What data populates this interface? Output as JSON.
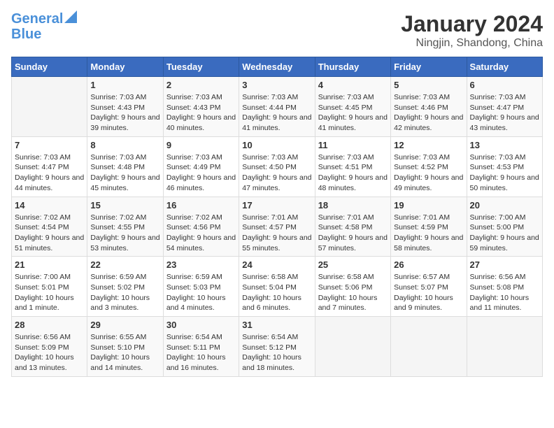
{
  "header": {
    "logo_line1": "General",
    "logo_line2": "Blue",
    "title": "January 2024",
    "subtitle": "Ningjin, Shandong, China"
  },
  "calendar": {
    "weekdays": [
      "Sunday",
      "Monday",
      "Tuesday",
      "Wednesday",
      "Thursday",
      "Friday",
      "Saturday"
    ],
    "weeks": [
      [
        {
          "day": "",
          "info": ""
        },
        {
          "day": "1",
          "info": "Sunrise: 7:03 AM\nSunset: 4:43 PM\nDaylight: 9 hours and 39 minutes."
        },
        {
          "day": "2",
          "info": "Sunrise: 7:03 AM\nSunset: 4:43 PM\nDaylight: 9 hours and 40 minutes."
        },
        {
          "day": "3",
          "info": "Sunrise: 7:03 AM\nSunset: 4:44 PM\nDaylight: 9 hours and 41 minutes."
        },
        {
          "day": "4",
          "info": "Sunrise: 7:03 AM\nSunset: 4:45 PM\nDaylight: 9 hours and 41 minutes."
        },
        {
          "day": "5",
          "info": "Sunrise: 7:03 AM\nSunset: 4:46 PM\nDaylight: 9 hours and 42 minutes."
        },
        {
          "day": "6",
          "info": "Sunrise: 7:03 AM\nSunset: 4:47 PM\nDaylight: 9 hours and 43 minutes."
        }
      ],
      [
        {
          "day": "7",
          "info": "Sunrise: 7:03 AM\nSunset: 4:47 PM\nDaylight: 9 hours and 44 minutes."
        },
        {
          "day": "8",
          "info": "Sunrise: 7:03 AM\nSunset: 4:48 PM\nDaylight: 9 hours and 45 minutes."
        },
        {
          "day": "9",
          "info": "Sunrise: 7:03 AM\nSunset: 4:49 PM\nDaylight: 9 hours and 46 minutes."
        },
        {
          "day": "10",
          "info": "Sunrise: 7:03 AM\nSunset: 4:50 PM\nDaylight: 9 hours and 47 minutes."
        },
        {
          "day": "11",
          "info": "Sunrise: 7:03 AM\nSunset: 4:51 PM\nDaylight: 9 hours and 48 minutes."
        },
        {
          "day": "12",
          "info": "Sunrise: 7:03 AM\nSunset: 4:52 PM\nDaylight: 9 hours and 49 minutes."
        },
        {
          "day": "13",
          "info": "Sunrise: 7:03 AM\nSunset: 4:53 PM\nDaylight: 9 hours and 50 minutes."
        }
      ],
      [
        {
          "day": "14",
          "info": "Sunrise: 7:02 AM\nSunset: 4:54 PM\nDaylight: 9 hours and 51 minutes."
        },
        {
          "day": "15",
          "info": "Sunrise: 7:02 AM\nSunset: 4:55 PM\nDaylight: 9 hours and 53 minutes."
        },
        {
          "day": "16",
          "info": "Sunrise: 7:02 AM\nSunset: 4:56 PM\nDaylight: 9 hours and 54 minutes."
        },
        {
          "day": "17",
          "info": "Sunrise: 7:01 AM\nSunset: 4:57 PM\nDaylight: 9 hours and 55 minutes."
        },
        {
          "day": "18",
          "info": "Sunrise: 7:01 AM\nSunset: 4:58 PM\nDaylight: 9 hours and 57 minutes."
        },
        {
          "day": "19",
          "info": "Sunrise: 7:01 AM\nSunset: 4:59 PM\nDaylight: 9 hours and 58 minutes."
        },
        {
          "day": "20",
          "info": "Sunrise: 7:00 AM\nSunset: 5:00 PM\nDaylight: 9 hours and 59 minutes."
        }
      ],
      [
        {
          "day": "21",
          "info": "Sunrise: 7:00 AM\nSunset: 5:01 PM\nDaylight: 10 hours and 1 minute."
        },
        {
          "day": "22",
          "info": "Sunrise: 6:59 AM\nSunset: 5:02 PM\nDaylight: 10 hours and 3 minutes."
        },
        {
          "day": "23",
          "info": "Sunrise: 6:59 AM\nSunset: 5:03 PM\nDaylight: 10 hours and 4 minutes."
        },
        {
          "day": "24",
          "info": "Sunrise: 6:58 AM\nSunset: 5:04 PM\nDaylight: 10 hours and 6 minutes."
        },
        {
          "day": "25",
          "info": "Sunrise: 6:58 AM\nSunset: 5:06 PM\nDaylight: 10 hours and 7 minutes."
        },
        {
          "day": "26",
          "info": "Sunrise: 6:57 AM\nSunset: 5:07 PM\nDaylight: 10 hours and 9 minutes."
        },
        {
          "day": "27",
          "info": "Sunrise: 6:56 AM\nSunset: 5:08 PM\nDaylight: 10 hours and 11 minutes."
        }
      ],
      [
        {
          "day": "28",
          "info": "Sunrise: 6:56 AM\nSunset: 5:09 PM\nDaylight: 10 hours and 13 minutes."
        },
        {
          "day": "29",
          "info": "Sunrise: 6:55 AM\nSunset: 5:10 PM\nDaylight: 10 hours and 14 minutes."
        },
        {
          "day": "30",
          "info": "Sunrise: 6:54 AM\nSunset: 5:11 PM\nDaylight: 10 hours and 16 minutes."
        },
        {
          "day": "31",
          "info": "Sunrise: 6:54 AM\nSunset: 5:12 PM\nDaylight: 10 hours and 18 minutes."
        },
        {
          "day": "",
          "info": ""
        },
        {
          "day": "",
          "info": ""
        },
        {
          "day": "",
          "info": ""
        }
      ]
    ]
  }
}
